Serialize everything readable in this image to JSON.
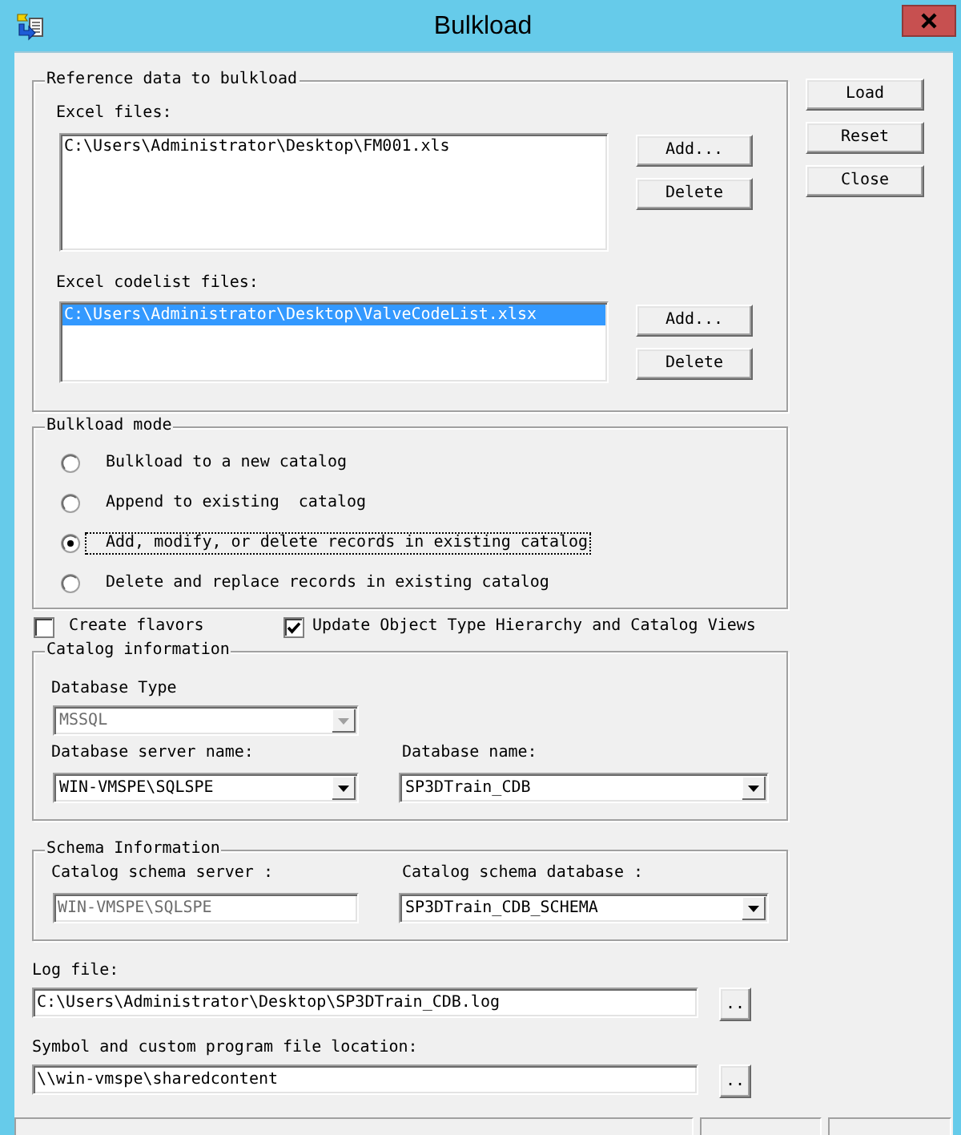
{
  "window": {
    "title": "Bulkload"
  },
  "reference_data": {
    "title": "Reference data to bulkload",
    "lists": [
      {
        "label": "Excel files:",
        "items": [
          {
            "text": "C:\\Users\\Administrator\\Desktop\\FM001.xls",
            "selected": false
          }
        ],
        "buttons": [
          "Add...",
          "Delete"
        ]
      },
      {
        "label": "Excel codelist files:",
        "items": [
          {
            "text": "C:\\Users\\Administrator\\Desktop\\ValveCodeList.xlsx",
            "selected": true
          }
        ],
        "buttons": [
          "Add...",
          "Delete"
        ]
      }
    ]
  },
  "side_buttons": [
    "Load",
    "Reset",
    "Close"
  ],
  "bulkload_mode": {
    "title": "Bulkload mode",
    "options": [
      {
        "label": "Bulkload to a new catalog",
        "selected": false,
        "focused": false
      },
      {
        "label": "Append to existing  catalog",
        "selected": false,
        "focused": false
      },
      {
        "label": "Add, modify, or delete records in existing catalog",
        "selected": true,
        "focused": true
      },
      {
        "label": "Delete and replace records in existing catalog",
        "selected": false,
        "focused": false
      }
    ]
  },
  "checkboxes": [
    {
      "label": "Create flavors",
      "checked": false
    },
    {
      "label": "Update Object Type Hierarchy and Catalog Views",
      "checked": true
    }
  ],
  "catalog_information": {
    "title": "Catalog information",
    "rows": [
      {
        "fields": [
          {
            "label": "Database Type",
            "kind": "combo",
            "value": "MSSQL",
            "disabled": true
          }
        ]
      },
      {
        "fields": [
          {
            "label": "Database server name:",
            "kind": "combo",
            "value": "WIN-VMSPE\\SQLSPE",
            "disabled": false
          },
          {
            "label": "Database name:",
            "kind": "combo",
            "value": "SP3DTrain_CDB",
            "disabled": false
          }
        ]
      }
    ]
  },
  "schema_information": {
    "title": "Schema Information",
    "rows": [
      {
        "fields": [
          {
            "label": "Catalog schema server :",
            "kind": "text",
            "value": "WIN-VMSPE\\SQLSPE",
            "disabled": true
          },
          {
            "label": "Catalog schema database :",
            "kind": "combo",
            "value": "SP3DTrain_CDB_SCHEMA",
            "disabled": false
          }
        ]
      }
    ]
  },
  "path_fields": [
    {
      "label": "Log file:",
      "value": "C:\\Users\\Administrator\\Desktop\\SP3DTrain_CDB.log",
      "button": ".."
    },
    {
      "label": "Symbol and custom program file location:",
      "value": "\\\\win-vmspe\\sharedcontent",
      "button": ".."
    }
  ]
}
